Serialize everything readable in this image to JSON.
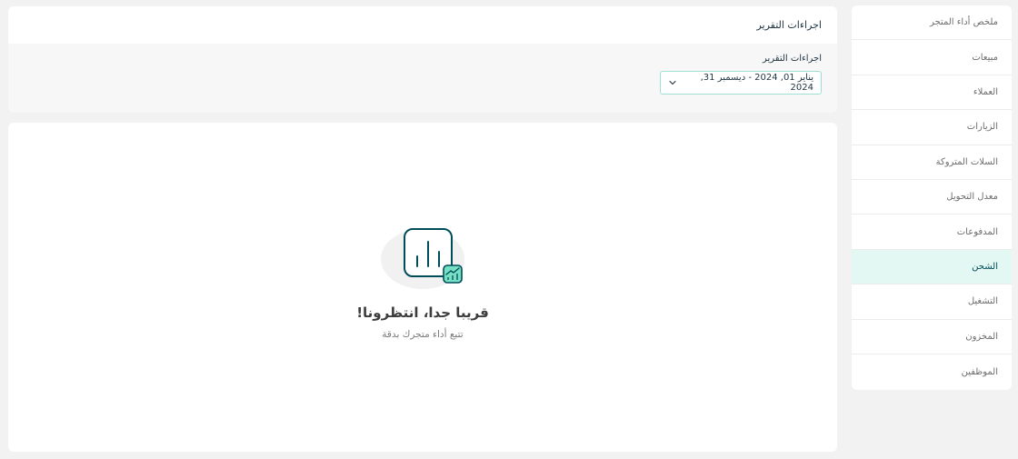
{
  "sidebar": {
    "items": [
      {
        "label": "ملخص أداء المتجر",
        "active": false
      },
      {
        "label": "مبيعات",
        "active": false
      },
      {
        "label": "العملاء",
        "active": false
      },
      {
        "label": "الزيارات",
        "active": false
      },
      {
        "label": "السلات المتروكة",
        "active": false
      },
      {
        "label": "معدل التحويل",
        "active": false
      },
      {
        "label": "المدفوعات",
        "active": false
      },
      {
        "label": "الشحن",
        "active": true
      },
      {
        "label": "التشغيل",
        "active": false
      },
      {
        "label": "المخزون",
        "active": false
      },
      {
        "label": "الموظفين",
        "active": false
      }
    ]
  },
  "report_actions": {
    "title": "اجراءات التقرير",
    "date_label": "اجراءات التقرير",
    "date_range": "يناير 01, 2024 - ديسمبر 31, 2024"
  },
  "empty_state": {
    "title": "قريبا جدا، انتظرونا!",
    "subtitle": "تتبع أداء متجرك بدقة",
    "icon": "chart-growth-icon"
  },
  "colors": {
    "accent": "#004d5a",
    "active_bg": "#e3f8f3",
    "badge": "#76e0c4",
    "border": "#9fe0d4"
  }
}
